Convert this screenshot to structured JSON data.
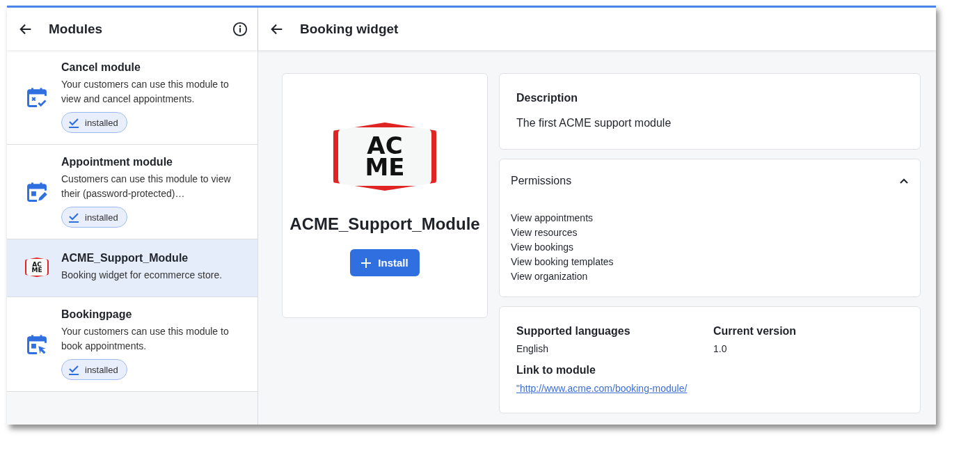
{
  "sidebar": {
    "title": "Modules",
    "items": [
      {
        "kind": "calendar-x",
        "name": "Cancel module",
        "description": [
          "Your customers can use this module to",
          "view and cancel appointments."
        ],
        "badge": "installed",
        "selected": false
      },
      {
        "kind": "calendar-edit",
        "name": "Appointment module",
        "description": [
          "Customers can use this module to view",
          "their (password-protected)…"
        ],
        "badge": "installed",
        "selected": false
      },
      {
        "kind": "logo",
        "logo_lines": [
          "AC",
          "ME"
        ],
        "name": "ACME_Support_Module",
        "description": [
          "Booking widget for ecommerce store."
        ],
        "selected": true
      },
      {
        "kind": "calendar-cursor",
        "name": "Bookingpage",
        "description": [
          "Your customers can use this module to",
          "book appointments."
        ],
        "badge": "installed",
        "selected": false
      }
    ]
  },
  "main": {
    "title": "Booking widget",
    "module_card": {
      "logo_lines": [
        "AC",
        "ME"
      ],
      "name": "ACME_Support_Module",
      "button": "Install"
    },
    "description": {
      "heading": "Description",
      "text": "The first ACME support module"
    },
    "permissions": {
      "heading": "Permissions",
      "expanded": true,
      "items": [
        "View appointments",
        "View resources",
        "View bookings",
        "View booking templates",
        "View organization"
      ]
    },
    "info": {
      "languages_label": "Supported languages",
      "languages": "English",
      "version_label": "Current version",
      "version": "1.0",
      "link_label": "Link to module",
      "link": "\"http://www.acme.com/booking-module/"
    }
  }
}
